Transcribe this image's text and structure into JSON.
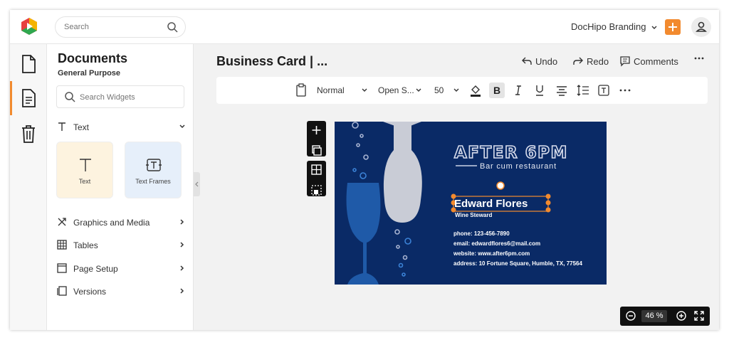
{
  "topbar": {
    "search_placeholder": "Search",
    "brand_label": "DocHipo Branding",
    "accent_color": "#f28a2e"
  },
  "panel": {
    "title": "Documents",
    "subtitle": "General Purpose",
    "widget_search_placeholder": "Search Widgets",
    "text_section": "Text",
    "cards": [
      {
        "label": "Text",
        "icon": "text-icon"
      },
      {
        "label": "Text Frames",
        "icon": "text-frame-icon"
      }
    ],
    "sections": [
      {
        "label": "Graphics and Media",
        "icon": "graphics-icon"
      },
      {
        "label": "Tables",
        "icon": "table-icon"
      },
      {
        "label": "Page Setup",
        "icon": "page-setup-icon"
      },
      {
        "label": "Versions",
        "icon": "versions-icon"
      }
    ]
  },
  "editor": {
    "doc_title": "Business Card | ...",
    "undo": "Undo",
    "redo": "Redo",
    "comments": "Comments",
    "toolbar": {
      "style": "Normal",
      "font": "Open S...",
      "size": "50"
    }
  },
  "card": {
    "brand_name": "AFTER 6PM",
    "tagline": "Bar cum restaurant",
    "person_name": "Edward Flores",
    "person_title": "Wine Steward",
    "phone": "phone: 123-456-7890",
    "email": "email: edwardflores6@mail.com",
    "website": "website: www.after6pm.com",
    "address": "address: 10 Fortune Square, Humble, TX, 77564",
    "bg_color": "#0a2a66"
  },
  "zoom": {
    "value": "46",
    "unit": "%"
  }
}
